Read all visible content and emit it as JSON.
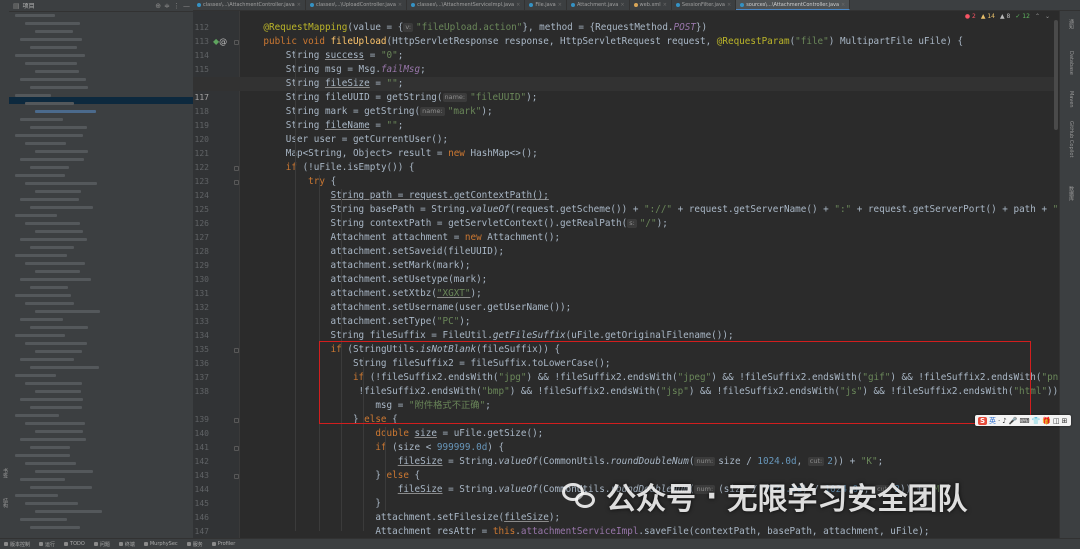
{
  "project_panel": {
    "title": "项目",
    "header_icons": [
      "target-icon",
      "collapse-icon",
      "settings-icon",
      "minimize-icon"
    ]
  },
  "tabs": [
    {
      "label": "classes\\...\\AttachmentController.java",
      "type": "java",
      "active": false
    },
    {
      "label": "classes\\...\\UploadController.java",
      "type": "java",
      "active": false
    },
    {
      "label": "classes\\...\\AttachmentServiceImpl.java",
      "type": "java",
      "active": false
    },
    {
      "label": "File.java",
      "type": "java",
      "active": false
    },
    {
      "label": "Attachment.java",
      "type": "java",
      "active": false
    },
    {
      "label": "web.xml",
      "type": "xml",
      "active": false
    },
    {
      "label": "SessionFilter.java",
      "type": "java",
      "active": false
    },
    {
      "label": "sources\\...\\AttachmentController.java",
      "type": "java",
      "active": true
    }
  ],
  "inspections": {
    "errors": "2",
    "warnings": "14",
    "weak": "8",
    "ok": "12"
  },
  "hints": {
    "value": "v:",
    "name": "name:",
    "s": "s:",
    "num": "num:",
    "cut": "cut:"
  },
  "code": {
    "line_numbers": [
      "112",
      "113",
      "114",
      "115",
      "116",
      "117",
      "118",
      "119",
      "120",
      "121",
      "122",
      "123",
      "124",
      "125",
      "126",
      "127",
      "128",
      "129",
      "130",
      "131",
      "132",
      "133",
      "134",
      "135",
      "136",
      "137",
      "138",
      "",
      "139",
      "140",
      "141",
      "142",
      "143",
      "144",
      "145",
      "146",
      "147",
      "148"
    ],
    "mapping_path": "\"fileUpload.action\"",
    "post": "POST",
    "file_param": "\"file\"",
    "str_zero": "\"0\"",
    "str_empty": "\"\"",
    "str_fileuuid": "\"fileUUID\"",
    "str_mark": "\"mark\"",
    "str_sep": "\"://\"",
    "str_colon": "\":\"",
    "str_slash": "\"/\"",
    "str_xgxt": "\"XGXT\"",
    "str_pc": "\"PC\"",
    "str_jpg": "\"jpg\"",
    "str_jpeg": "\"jpeg\"",
    "str_gif": "\"gif\"",
    "str_png": "\"png\"",
    "str_bmp": "\"bmp\"",
    "str_jsp": "\"jsp\"",
    "str_js": "\"js\"",
    "str_html": "\"html\"",
    "str_msg_cn": "\"附件格式不正确\"",
    "num_limit": "999999.0d",
    "num_1024": "1024.0d",
    "num_2": "2",
    "str_k": "\"K\"",
    "fail_msg": "failMsg"
  },
  "ime": {
    "logo": "S",
    "items": [
      "英",
      "·",
      "♪",
      "🎤",
      "⌨",
      "👕",
      "🎁",
      "◫",
      "⊞"
    ]
  },
  "watermark": {
    "prefix": "公众号",
    "separator": "·",
    "name": "无限学习安全团队"
  },
  "status_bar": {
    "items": [
      "版本控制",
      "运行",
      "TODO",
      "问题",
      "终端",
      "MurphySec",
      "服务",
      "Profiler"
    ]
  },
  "right_tools": [
    "通知",
    "Database",
    "Maven",
    "GitHub Copilot",
    "数据库"
  ],
  "left_tools": [
    "书签",
    "结构"
  ]
}
